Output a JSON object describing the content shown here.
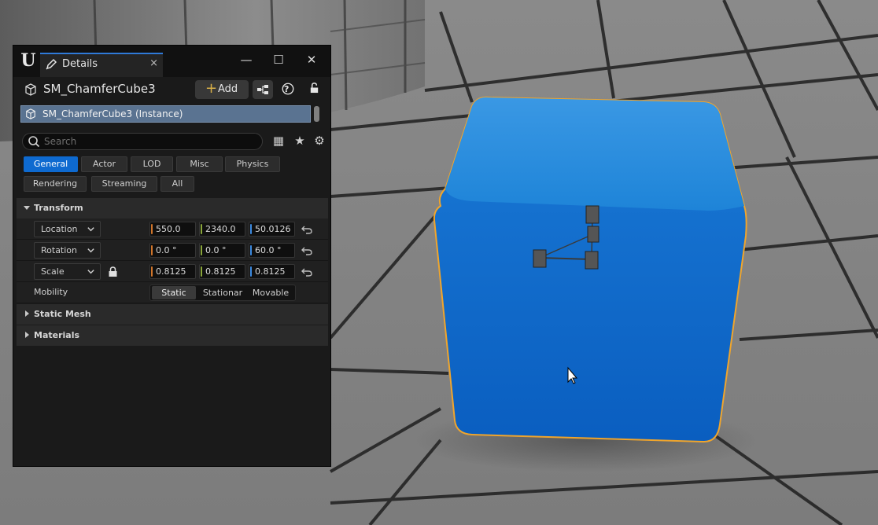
{
  "window": {
    "tab_title": "Details",
    "tab_close": "×",
    "minimize_glyph": "—",
    "maximize_glyph": "☐",
    "close_glyph": "✕",
    "logo_glyph": "U"
  },
  "header": {
    "object_name": "SM_ChamferCube3",
    "add_label": "Add",
    "add_plus": "+",
    "help_glyph": "?",
    "lock_glyph": "🔓"
  },
  "instance": {
    "label": "SM_ChamferCube3 (Instance)"
  },
  "search": {
    "placeholder": "Search"
  },
  "toolbar": {
    "table_glyph": "▦",
    "star_glyph": "★",
    "gear_glyph": "⚙"
  },
  "categories": [
    "General",
    "Actor",
    "LOD",
    "Misc",
    "Physics",
    "Rendering",
    "Streaming",
    "All"
  ],
  "sections": {
    "transform": "Transform",
    "static_mesh": "Static Mesh",
    "materials": "Materials"
  },
  "transform": {
    "location": {
      "label": "Location",
      "x": "550.0",
      "y": "2340.0",
      "z": "50.0126"
    },
    "rotation": {
      "label": "Rotation",
      "x": "0.0 °",
      "y": "0.0 °",
      "z": "60.0 °"
    },
    "scale": {
      "label": "Scale",
      "x": "0.8125",
      "y": "0.8125",
      "z": "0.8125"
    }
  },
  "mobility": {
    "label": "Mobility",
    "options": [
      "Static",
      "Stationar",
      "Movable"
    ],
    "selected": "Static"
  },
  "colors": {
    "accent": "#0e6ad0",
    "cube": "#1f7ad6",
    "selection_outline": "#f0a52c",
    "x_axis": "#d0752a",
    "y_axis": "#8aa63a",
    "z_axis": "#3c8ae0"
  }
}
